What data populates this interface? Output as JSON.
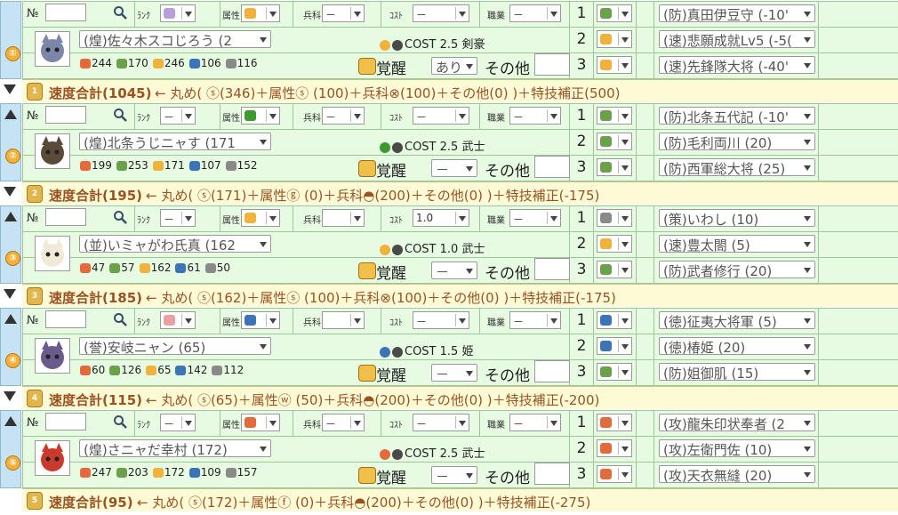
{
  "labels": {
    "no": "№",
    "rank": "ﾗﾝｸ",
    "attr": "属性",
    "heika": "兵科",
    "cost": "ｺｽﾄ",
    "job": "職業",
    "kakusei": "覚醒",
    "other": "その他",
    "sum": "速度合計"
  },
  "colors": {
    "row_bg": "#e6fbe2",
    "gutter_bg": "#c6e3f4",
    "summary_bg": "#fdfbd6",
    "summary_text": "#9a5222",
    "badge": "#f3b13a"
  },
  "blocks": [
    {
      "index": "①",
      "has_up": false,
      "has_down": true,
      "filters": {
        "rank_icon": "rank-purple-icon",
        "rank": "",
        "attr_icon": "sun-attr-icon",
        "attr": "",
        "heika": "－",
        "cost": "－",
        "job": "－"
      },
      "skills": [
        {
          "slot": "1",
          "type_icon": "defense-icon",
          "label": "(防)真田伊豆守 (-10'"
        },
        {
          "slot": "2",
          "type_icon": "speed-icon",
          "label": "(速)悲願成就Lv5 (-5("
        },
        {
          "slot": "3",
          "type_icon": "speed-icon",
          "label": "(速)先鋒隊大将 (-40'"
        }
      ],
      "unit": {
        "name": "(煌)佐々木スコじろう (2",
        "cost_text": "COST 2.5 剣豪",
        "stats": {
          "atk": "244",
          "def": "170",
          "spd": "246",
          "vir": "106",
          "str": "116"
        },
        "kakusei_value": "あり",
        "other_value": ""
      },
      "summary": "← 丸め( ⓢ(346)＋属性ⓢ (100)＋兵科⊗(100)＋その他(0) )＋特技補正(500)",
      "summary_total": "(1045)",
      "summary_icon": "1"
    },
    {
      "index": "②",
      "has_up": true,
      "has_down": true,
      "filters": {
        "rank_icon": "",
        "rank": "－",
        "attr_icon": "grass-attr-icon",
        "attr": "",
        "heika": "－",
        "cost": "－",
        "job": "－"
      },
      "skills": [
        {
          "slot": "1",
          "type_icon": "defense-icon",
          "label": "(防)北条五代記 (-10'"
        },
        {
          "slot": "2",
          "type_icon": "defense-icon",
          "label": "(防)毛利両川 (20)"
        },
        {
          "slot": "3",
          "type_icon": "defense-icon",
          "label": "(防)西軍総大将 (25)"
        }
      ],
      "unit": {
        "name": "(煌)北条うじニャす (171",
        "cost_text": "COST 2.5 武士",
        "stats": {
          "atk": "199",
          "def": "253",
          "spd": "171",
          "vir": "107",
          "str": "152"
        },
        "kakusei_value": "－",
        "other_value": ""
      },
      "summary": "← 丸め( ⓢ(171)＋属性ⓖ (0)＋兵科◓(200)＋その他(0) )＋特技補正(-175)",
      "summary_total": "(195)",
      "summary_icon": "2"
    },
    {
      "index": "③",
      "has_up": true,
      "has_down": true,
      "filters": {
        "rank_icon": "",
        "rank": "－",
        "attr_icon": "sun-attr-icon",
        "attr": "",
        "heika": "",
        "cost": "1.0",
        "job": "－"
      },
      "skills": [
        {
          "slot": "1",
          "type_icon": "strategy-icon",
          "label": "(策)いわし (10)"
        },
        {
          "slot": "2",
          "type_icon": "speed-icon",
          "label": "(速)豊太閤 (5)"
        },
        {
          "slot": "3",
          "type_icon": "defense-icon",
          "label": "(防)武者修行 (20)"
        }
      ],
      "unit": {
        "name": "(並)いミャがわ氏真 (162",
        "cost_text": "COST 1.0 武士",
        "stats": {
          "atk": "47",
          "def": "57",
          "spd": "162",
          "vir": "61",
          "str": "50"
        },
        "kakusei_value": "－",
        "other_value": ""
      },
      "summary": "← 丸め( ⓢ(162)＋属性ⓢ (100)＋兵科⊗(100)＋その他(0) )＋特技補正(-175)",
      "summary_total": "(185)",
      "summary_icon": "3"
    },
    {
      "index": "④",
      "has_up": true,
      "has_down": true,
      "filters": {
        "rank_icon": "rank-red-icon",
        "rank": "",
        "attr_icon": "water-attr-icon",
        "attr": "",
        "heika": "",
        "cost": "－",
        "job": "－"
      },
      "skills": [
        {
          "slot": "1",
          "type_icon": "virtue-icon",
          "label": "(徳)征夷大将軍 (5)"
        },
        {
          "slot": "2",
          "type_icon": "virtue-icon",
          "label": "(徳)椿姫 (20)"
        },
        {
          "slot": "3",
          "type_icon": "defense-icon",
          "label": "(防)姐御肌 (15)"
        }
      ],
      "unit": {
        "name": "(誉)安岐ニャン (65)",
        "cost_text": "COST 1.5 姫",
        "stats": {
          "atk": "60",
          "def": "126",
          "spd": "65",
          "vir": "142",
          "str": "112"
        },
        "kakusei_value": "－",
        "other_value": ""
      },
      "summary": "← 丸め( ⓢ(65)＋属性ⓦ (50)＋兵科◓(200)＋その他(0) )＋特技補正(-200)",
      "summary_total": "(115)",
      "summary_icon": "4"
    },
    {
      "index": "⑤",
      "has_up": true,
      "has_down": false,
      "filters": {
        "rank_icon": "",
        "rank": "－",
        "attr_icon": "fire-attr-icon",
        "attr": "",
        "heika": "－",
        "cost": "－",
        "job": "－"
      },
      "skills": [
        {
          "slot": "1",
          "type_icon": "attack-icon",
          "label": "(攻)龍朱印状奉者 (2"
        },
        {
          "slot": "2",
          "type_icon": "attack-icon",
          "label": "(攻)左衛門佐 (10)"
        },
        {
          "slot": "3",
          "type_icon": "attack-icon",
          "label": "(攻)天衣無縫 (20)"
        }
      ],
      "unit": {
        "name": "(煌)さニャだ幸村 (172)",
        "cost_text": "COST 2.5 武士",
        "stats": {
          "atk": "247",
          "def": "203",
          "spd": "172",
          "vir": "109",
          "str": "157"
        },
        "kakusei_value": "－",
        "other_value": ""
      },
      "summary": "← 丸め( ⓢ(172)＋属性ⓕ (0)＋兵科◓(200)＋その他(0) )＋特技補正(-275)",
      "summary_total": "(95)",
      "summary_icon": "5"
    }
  ]
}
